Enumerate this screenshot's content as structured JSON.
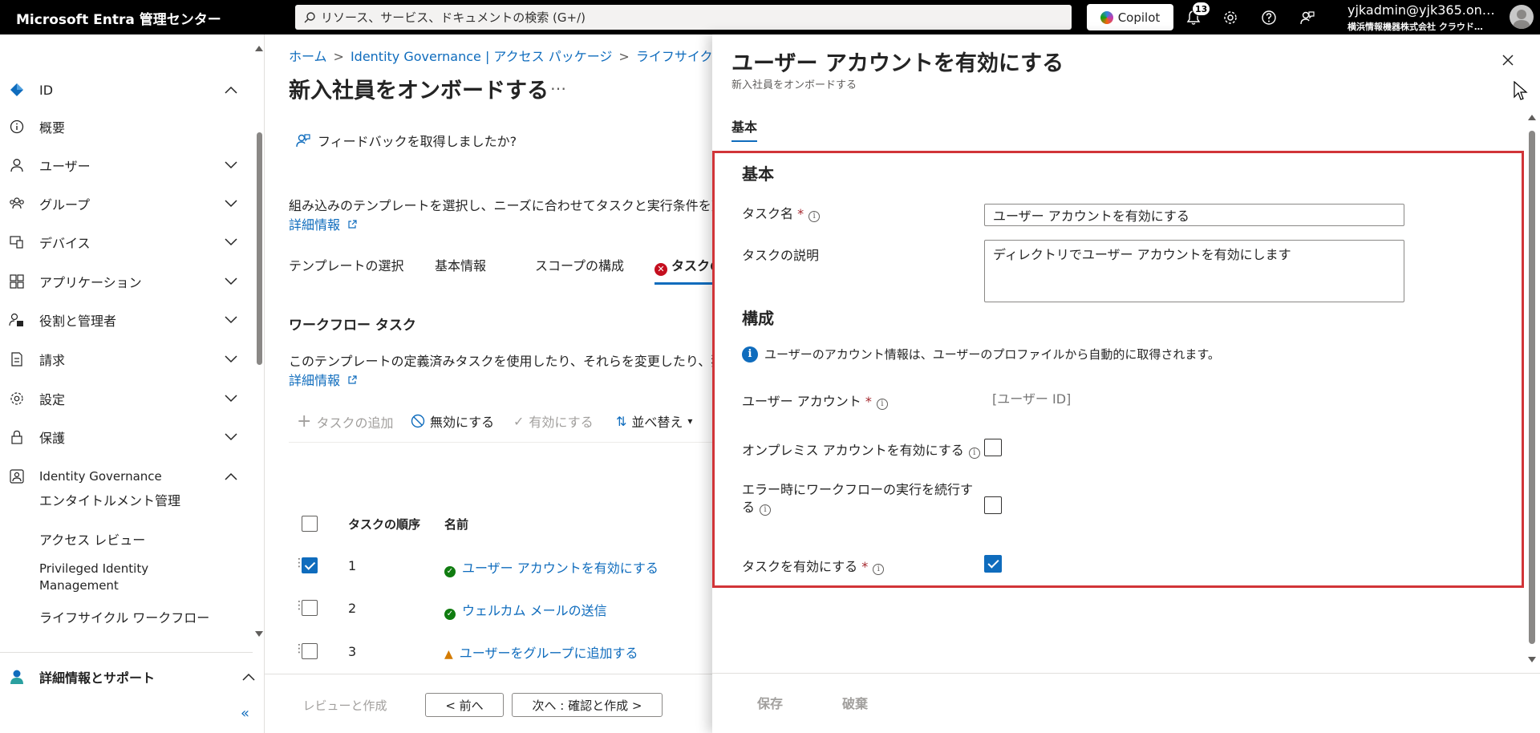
{
  "topbar": {
    "brand": "Microsoft Entra 管理センター",
    "search_placeholder": "リソース、サービス、ドキュメントの検索 (G+/)",
    "copilot_label": "Copilot",
    "notification_count": "13",
    "user_name": "yjkadmin@yjk365.on…",
    "user_org": "横浜情報機器株式会社 クラウド…"
  },
  "sidebar": {
    "items": [
      {
        "label": "ID",
        "icon": "diamond-icon"
      },
      {
        "label": "概要",
        "icon": "info-icon"
      },
      {
        "label": "ユーザー",
        "icon": "person-icon"
      },
      {
        "label": "グループ",
        "icon": "group-icon"
      },
      {
        "label": "デバイス",
        "icon": "device-icon"
      },
      {
        "label": "アプリケーション",
        "icon": "apps-icon"
      },
      {
        "label": "役割と管理者",
        "icon": "role-icon"
      },
      {
        "label": "請求",
        "icon": "billing-icon"
      },
      {
        "label": "設定",
        "icon": "gear-icon"
      },
      {
        "label": "保護",
        "icon": "lock-icon"
      },
      {
        "label": "Identity Governance",
        "icon": "governance-icon"
      }
    ],
    "subitems": [
      "エンタイトルメント管理",
      "アクセス レビュー",
      "Privileged Identity",
      "Management",
      "ライフサイクル ワークフロー"
    ],
    "bottom_item": "詳細情報とサポート",
    "collapse_label": "«"
  },
  "main": {
    "breadcrumb": [
      "ホーム",
      "Identity Governance | アクセス パッケージ",
      "ライフサイクル ワークフロー"
    ],
    "title": "新入社員をオンボードする",
    "title_more": "…",
    "feedback": "フィードバックを取得しましたか?",
    "intro": "組み込みのテンプレートを選択し、ニーズに合わせてタスクと実行条件を変更します。",
    "learn_more": "詳細情報",
    "tabs": [
      "テンプレートの選択",
      "基本情報",
      "スコープの構成",
      "タスクの確認"
    ],
    "workflow_title": "ワークフロー タスク",
    "workflow_desc": "このテンプレートの定義済みタスクを使用したり、それらを変更したり、独自のタスクを追加したりします。",
    "toolbar": {
      "add": "タスクの追加",
      "disable": "無効にする",
      "enable": "有効にする",
      "sort": "並べ替え"
    },
    "table": {
      "col_order": "タスクの順序",
      "col_name": "名前",
      "rows": [
        {
          "order": "1",
          "name": "ユーザー アカウントを有効にする",
          "status": "ok",
          "checked": true
        },
        {
          "order": "2",
          "name": "ウェルカム メールの送信",
          "status": "ok",
          "checked": false
        },
        {
          "order": "3",
          "name": "ユーザーをグループに追加する",
          "status": "warning",
          "checked": false
        }
      ]
    },
    "footer": {
      "review": "レビューと作成",
      "prev": "< 前へ",
      "next": "次へ : 確認と作成 >"
    }
  },
  "panel": {
    "title": "ユーザー アカウントを有効にする",
    "subtitle": "新入社員をオンボードする",
    "tab": "基本",
    "section_basic": "基本",
    "task_name_label": "タスク名",
    "task_name_value": "ユーザー アカウントを有効にする",
    "task_desc_label": "タスクの説明",
    "task_desc_value": "ディレクトリでユーザー アカウントを有効にします",
    "section_config": "構成",
    "info_text": "ユーザーのアカウント情報は、ユーザーのプロファイルから自動的に取得されます。",
    "user_account_label": "ユーザー アカウント",
    "user_account_placeholder": "[ユーザー ID]",
    "onprem_label": "オンプレミス アカウントを有効にする",
    "continue_label_1": "エラー時にワークフローの実行を続行す",
    "continue_label_2": "る",
    "enable_task_label": "タスクを有効にする",
    "required_mark": "*",
    "info_glyph": "i",
    "save": "保存",
    "discard": "破棄"
  },
  "colors": {
    "accent": "#0f6cbd",
    "highlight_box": "#d13438",
    "success": "#107c10",
    "warning": "#d47b00"
  }
}
